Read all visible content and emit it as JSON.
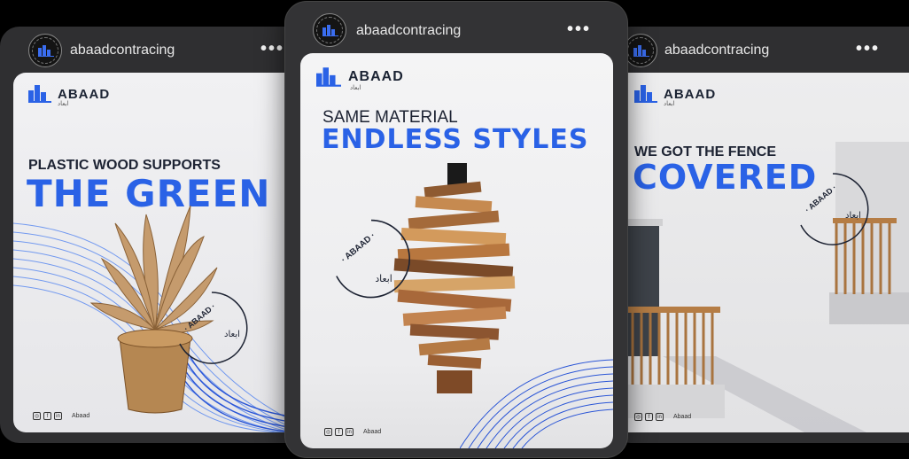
{
  "cards": {
    "left": {
      "handle": "abaadcontracing",
      "brand": "ABAAD",
      "brand_sub": "ابعاد",
      "kicker": "PLASTIC WOOD SUPPORTS",
      "headline": "THE GREEN",
      "social_icons": [
        "instagram-icon",
        "facebook-icon",
        "linkedin-icon"
      ],
      "footer_name": "Abaad"
    },
    "center": {
      "handle": "abaadcontracing",
      "brand": "ABAAD",
      "brand_sub": "ابعاد",
      "kicker": "SAME MATERIAL",
      "headline": "ENDLESS STYLES",
      "social_icons": [
        "instagram-icon",
        "facebook-icon",
        "linkedin-icon"
      ],
      "footer_name": "Abaad"
    },
    "right": {
      "handle": "abaadcontracing",
      "brand": "ABAAD",
      "brand_sub": "ابعاد",
      "kicker": "WE GOT THE FENCE",
      "headline": "COVERED",
      "social_icons": [
        "instagram-icon",
        "facebook-icon",
        "linkedin-icon"
      ],
      "footer_name": "Abaad"
    }
  },
  "stamp_text": "· ABAAD ·",
  "avatar_text": "ABAAD",
  "menu_glyph": "•••",
  "social_glyphs": {
    "instagram": "◎",
    "facebook": "f",
    "linkedin": "in"
  },
  "colors": {
    "accent": "#2a62e6",
    "dark_text": "#1d2333",
    "card_bg": "#2f2f31"
  }
}
